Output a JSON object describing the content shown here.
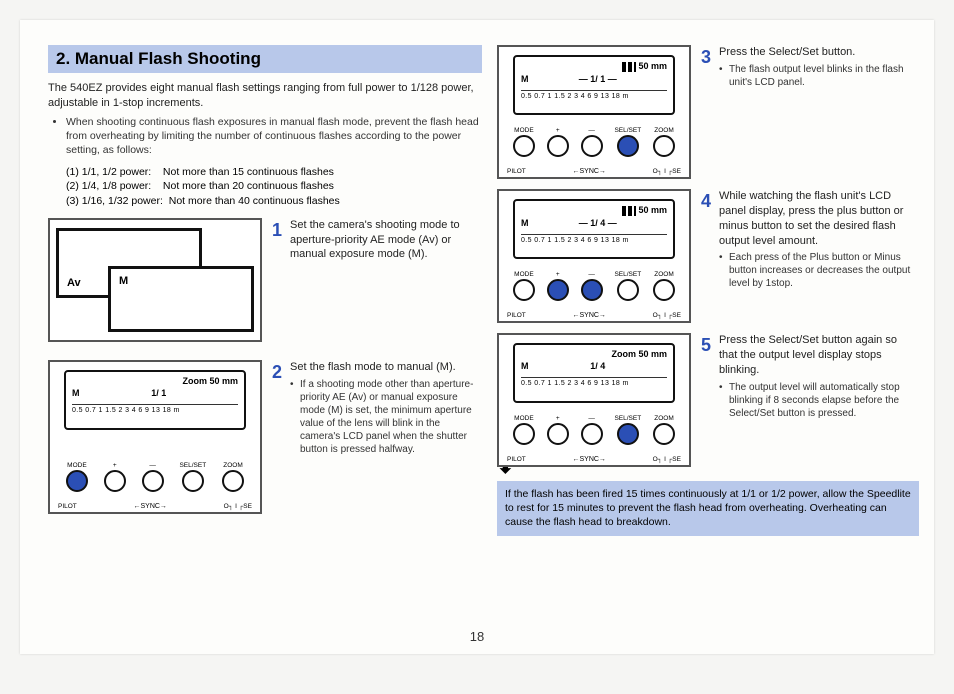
{
  "section_title": "2. Manual Flash Shooting",
  "intro": "The 540EZ provides eight manual flash settings ranging from full power to 1/128 power, adjustable in 1-stop increments.",
  "overheat_note": "When shooting continuous flash exposures in manual flash mode, prevent the flash head from overheating by limiting the number of continuous flashes according to the power setting, as follows:",
  "limits": [
    {
      "label": "(1) 1/1, 1/2 power:",
      "value": "Not more than 15 continuous flashes"
    },
    {
      "label": "(2) 1/4, 1/8 power:",
      "value": "Not more than 20 continuous flashes"
    },
    {
      "label": "(3) 1/16, 1/32 power:",
      "value": "Not more than 40 continuous flashes"
    }
  ],
  "camera_mode_fig": {
    "av": "Av",
    "m": "M"
  },
  "lcd": {
    "zoom_label": "Zoom",
    "zoom_value": "50 mm",
    "mode_m": "M",
    "ratio1": "1/ 1",
    "ratio2": "1/ 1 —",
    "ratio3": "1/ 4 —",
    "ratio4": "1/ 4",
    "scale": "0.5 0.7 1 1.5 2 3 4 6 9 13 18 m",
    "btn_mode": "MODE",
    "btn_plus": "+",
    "btn_minus": "—",
    "btn_selset": "SEL/SET",
    "btn_zoom": "ZOOM",
    "pilot": "PILOT",
    "sync": "←SYNC→",
    "off_on": "O┐ I ┌SE"
  },
  "steps": {
    "s1": {
      "num": "1",
      "text": "Set the camera's shooting mode to aperture-priority AE mode (Av) or manual exposure mode (M)."
    },
    "s2": {
      "num": "2",
      "text": "Set the flash mode to manual (M).",
      "bullet": "If a shooting mode other than aperture-priority AE (Av) or manual exposure mode (M) is set, the minimum aperture value of the lens will blink in the camera's LCD panel when the shutter button is pressed halfway."
    },
    "s3": {
      "num": "3",
      "text": "Press the Select/Set button.",
      "bullet": "The flash output level blinks in the flash unit's LCD panel."
    },
    "s4": {
      "num": "4",
      "text": "While watching the flash unit's LCD panel display, press the plus button or minus button to set the desired flash output level amount.",
      "bullet": "Each press of the Plus button or Minus button increases or decreases the output level by 1stop."
    },
    "s5": {
      "num": "5",
      "text": "Press the Select/Set button again so that the output level display stops blinking.",
      "bullet": "The output level will automatically stop blinking if 8 seconds elapse before the Select/Set button is pressed."
    }
  },
  "warning": "If the flash has been fired 15 times continuously at 1/1 or 1/2 power, allow the Speedlite to rest for 15 minutes to prevent the flash head from overheating. Overheating can cause the flash head to breakdown.",
  "page_number": "18"
}
